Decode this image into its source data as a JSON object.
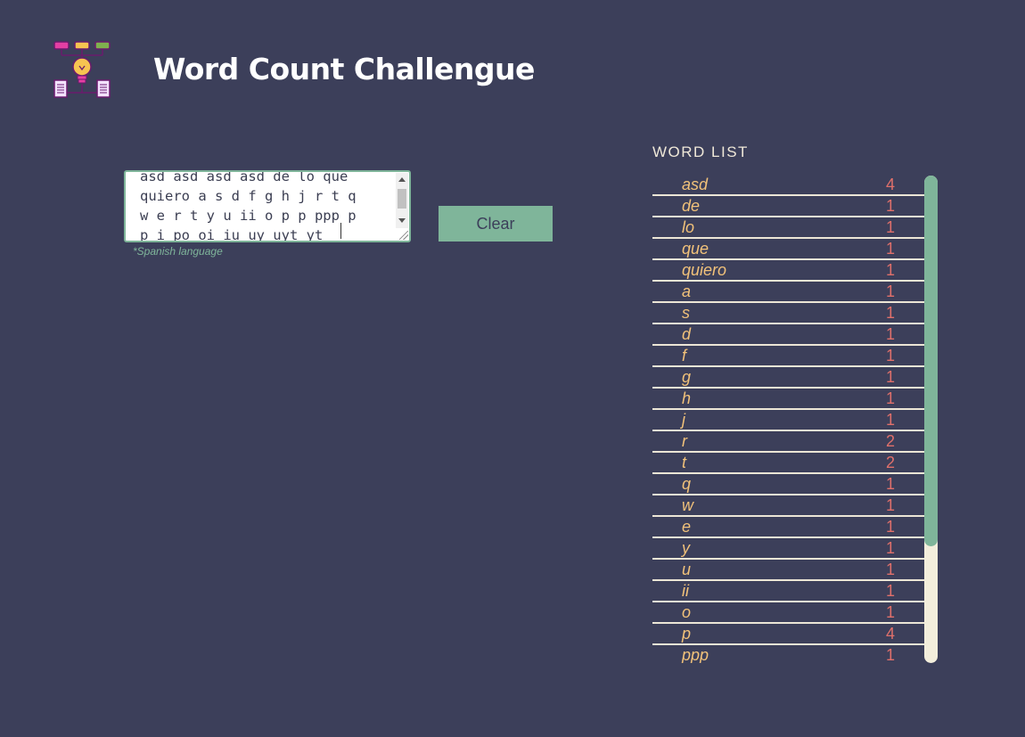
{
  "header": {
    "title": "Word Count Challengue"
  },
  "editor": {
    "lines": [
      "asd asd asd asd de lo que",
      "quiero a s d f g h j r t q",
      "w e r t y u ii o p p ppp p",
      "p i po oi iu uy uyt yt"
    ],
    "note": "*Spanish language"
  },
  "clear_button": {
    "label": "Clear"
  },
  "word_list": {
    "heading": "WORD LIST",
    "items": [
      {
        "word": "asd",
        "count": "4"
      },
      {
        "word": "de",
        "count": "1"
      },
      {
        "word": "lo",
        "count": "1"
      },
      {
        "word": "que",
        "count": "1"
      },
      {
        "word": "quiero",
        "count": "1"
      },
      {
        "word": "a",
        "count": "1"
      },
      {
        "word": "s",
        "count": "1"
      },
      {
        "word": "d",
        "count": "1"
      },
      {
        "word": "f",
        "count": "1"
      },
      {
        "word": "g",
        "count": "1"
      },
      {
        "word": "h",
        "count": "1"
      },
      {
        "word": "j",
        "count": "1"
      },
      {
        "word": "r",
        "count": "2"
      },
      {
        "word": "t",
        "count": "2"
      },
      {
        "word": "q",
        "count": "1"
      },
      {
        "word": "w",
        "count": "1"
      },
      {
        "word": "e",
        "count": "1"
      },
      {
        "word": "y",
        "count": "1"
      },
      {
        "word": "u",
        "count": "1"
      },
      {
        "word": "ii",
        "count": "1"
      },
      {
        "word": "o",
        "count": "1"
      },
      {
        "word": "p",
        "count": "4"
      },
      {
        "word": "ppp",
        "count": "1"
      }
    ]
  },
  "colors": {
    "background": "#3c3f5a",
    "accent": "#7fb59a",
    "word": "#f2c27a",
    "count": "#e0706b",
    "divider": "#ece6d6"
  },
  "icons": {
    "logo": "idea-lightbulb-documents-icon"
  }
}
